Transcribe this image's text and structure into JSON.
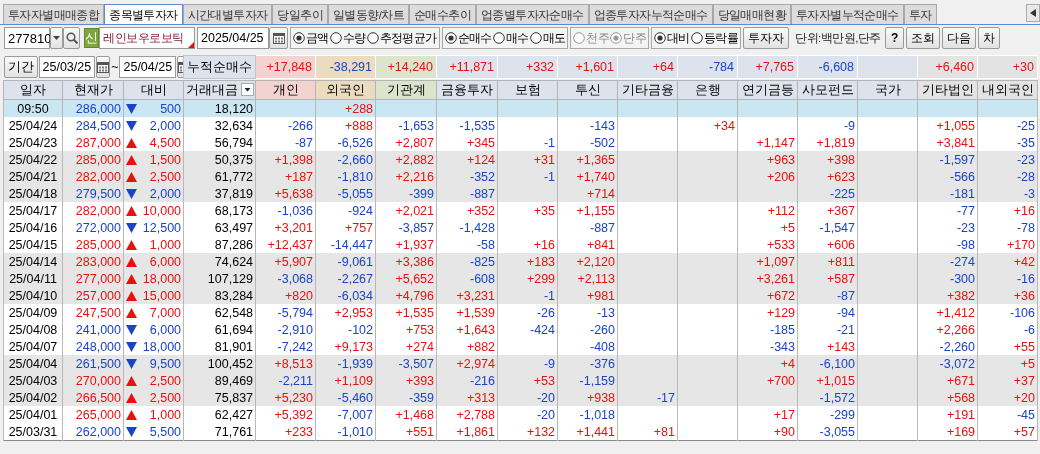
{
  "tabs": [
    {
      "label": "투자자별매매종합",
      "selected": false
    },
    {
      "label": "종목별투자자",
      "selected": true
    },
    {
      "label": "시간대별투자자",
      "selected": false
    },
    {
      "label": "당일추이",
      "selected": false
    },
    {
      "label": "일별동향/차트",
      "selected": false
    },
    {
      "label": "순매수추이",
      "selected": false
    },
    {
      "label": "업종별투자자순매수",
      "selected": false
    },
    {
      "label": "업종투자자누적순매수",
      "selected": false
    },
    {
      "label": "당일매매현황",
      "selected": false
    },
    {
      "label": "투자자별누적순매수",
      "selected": false
    },
    {
      "label": "투자",
      "selected": false
    }
  ],
  "toolbar": {
    "stock_code": "277810",
    "market_badge": "신",
    "stock_name": "레인보우로보틱",
    "date": "2025/04/25",
    "option_groups": [
      {
        "disabled": false,
        "options": [
          {
            "label": "금액",
            "selected": true
          },
          {
            "label": "수량",
            "selected": false
          },
          {
            "label": "추정평균가",
            "selected": false
          }
        ]
      },
      {
        "disabled": false,
        "options": [
          {
            "label": "순매수",
            "selected": true
          },
          {
            "label": "매수",
            "selected": false
          },
          {
            "label": "매도",
            "selected": false
          }
        ]
      },
      {
        "disabled": true,
        "options": [
          {
            "label": "천주",
            "selected": false
          },
          {
            "label": "단주",
            "selected": true
          }
        ]
      },
      {
        "disabled": false,
        "options": [
          {
            "label": "대비",
            "selected": true
          },
          {
            "label": "등락률",
            "selected": false
          }
        ]
      }
    ],
    "investor_button": "투자자",
    "unit": "단위:백만원,단주",
    "buttons": [
      "?",
      "조회",
      "다음",
      "차"
    ]
  },
  "period": {
    "label": "기간",
    "from": "25/03/25",
    "separator": "~",
    "to": "25/04/25"
  },
  "table": {
    "columns": [
      {
        "label": "일자"
      },
      {
        "label": "현재가"
      },
      {
        "label": "대비"
      },
      {
        "label": "거래대금",
        "has_menu": true
      },
      {
        "label": "개인",
        "color": "#f2d3cf"
      },
      {
        "label": "외국인",
        "color": "#ebdcc0"
      },
      {
        "label": "기관계",
        "color": "#dce5cb"
      },
      {
        "label": "금융투자",
        "color": "#dce3ec"
      },
      {
        "label": "보험",
        "color": "#dce3ec"
      },
      {
        "label": "투신",
        "color": "#dce3ec"
      },
      {
        "label": "기타금융",
        "color": "#dce3ec"
      },
      {
        "label": "은행",
        "color": "#dce3ec"
      },
      {
        "label": "연기금등",
        "color": "#dce3ec"
      },
      {
        "label": "사모펀드",
        "color": "#dce3ec"
      },
      {
        "label": "국가",
        "color": "#dce3ec"
      },
      {
        "label": "기타법인",
        "color": "#e3e3e3"
      },
      {
        "label": "내외국인",
        "color": "#e3e3e3"
      }
    ],
    "cumulative": {
      "label": "누적순매수",
      "values": {
        "individual": "+17,848",
        "foreign": "-38,291",
        "institution": "+14,240",
        "financial_investment": "+11,871",
        "insurance": "+332",
        "trust": "+1,601",
        "other_finance": "+64",
        "bank": "-784",
        "pension": "+7,765",
        "private_fund": "-6,608",
        "other_corp": "+6,460",
        "domestic_foreign": "+30"
      }
    },
    "rows": [
      {
        "date": "09:50",
        "price": "286,000",
        "up": false,
        "change": "500",
        "amount": "18,120",
        "live": true,
        "shaded": false,
        "flows": {
          "foreign": "+288"
        }
      },
      {
        "date": "25/04/24",
        "price": "284,500",
        "up": false,
        "change": "2,000",
        "amount": "32,634",
        "live": false,
        "shaded": false,
        "flows": {
          "individual": "-266",
          "foreign": "+888",
          "institution": "-1,653",
          "financial_investment": "-1,535",
          "trust": "-143",
          "bank": "+34",
          "private_fund": "-9",
          "other_corp": "+1,055",
          "domestic_foreign": "-25"
        }
      },
      {
        "date": "25/04/23",
        "price": "287,000",
        "up": true,
        "change": "4,500",
        "amount": "56,794",
        "live": false,
        "shaded": false,
        "flows": {
          "individual": "-87",
          "foreign": "-6,526",
          "institution": "+2,807",
          "financial_investment": "+345",
          "insurance": "-1",
          "trust": "-502",
          "pension": "+1,147",
          "private_fund": "+1,819",
          "other_corp": "+3,841",
          "domestic_foreign": "-35"
        }
      },
      {
        "date": "25/04/22",
        "price": "285,000",
        "up": true,
        "change": "1,500",
        "amount": "50,375",
        "live": false,
        "shaded": true,
        "flows": {
          "individual": "+1,398",
          "foreign": "-2,660",
          "institution": "+2,882",
          "financial_investment": "+124",
          "insurance": "+31",
          "trust": "+1,365",
          "pension": "+963",
          "private_fund": "+398",
          "other_corp": "-1,597",
          "domestic_foreign": "-23"
        }
      },
      {
        "date": "25/04/21",
        "price": "282,000",
        "up": true,
        "change": "2,500",
        "amount": "61,772",
        "live": false,
        "shaded": true,
        "flows": {
          "individual": "+187",
          "foreign": "-1,810",
          "institution": "+2,216",
          "financial_investment": "-352",
          "insurance": "-1",
          "trust": "+1,740",
          "pension": "+206",
          "private_fund": "+623",
          "other_corp": "-566",
          "domestic_foreign": "-28"
        }
      },
      {
        "date": "25/04/18",
        "price": "279,500",
        "up": false,
        "change": "2,000",
        "amount": "37,819",
        "live": false,
        "shaded": true,
        "flows": {
          "individual": "+5,638",
          "foreign": "-5,055",
          "institution": "-399",
          "financial_investment": "-887",
          "trust": "+714",
          "private_fund": "-225",
          "other_corp": "-181",
          "domestic_foreign": "-3"
        }
      },
      {
        "date": "25/04/17",
        "price": "282,000",
        "up": true,
        "change": "10,000",
        "amount": "68,173",
        "live": false,
        "shaded": false,
        "flows": {
          "individual": "-1,036",
          "foreign": "-924",
          "institution": "+2,021",
          "financial_investment": "+352",
          "insurance": "+35",
          "trust": "+1,155",
          "pension": "+112",
          "private_fund": "+367",
          "other_corp": "-77",
          "domestic_foreign": "+16"
        }
      },
      {
        "date": "25/04/16",
        "price": "272,000",
        "up": false,
        "change": "12,500",
        "amount": "63,497",
        "live": false,
        "shaded": false,
        "flows": {
          "individual": "+3,201",
          "foreign": "+757",
          "institution": "-3,857",
          "financial_investment": "-1,428",
          "trust": "-887",
          "pension": "+5",
          "private_fund": "-1,547",
          "other_corp": "-23",
          "domestic_foreign": "-78"
        }
      },
      {
        "date": "25/04/15",
        "price": "285,000",
        "up": true,
        "change": "1,000",
        "amount": "87,286",
        "live": false,
        "shaded": false,
        "flows": {
          "individual": "+12,437",
          "foreign": "-14,447",
          "institution": "+1,937",
          "financial_investment": "-58",
          "insurance": "+16",
          "trust": "+841",
          "pension": "+533",
          "private_fund": "+606",
          "other_corp": "-98",
          "domestic_foreign": "+170"
        }
      },
      {
        "date": "25/04/14",
        "price": "283,000",
        "up": true,
        "change": "6,000",
        "amount": "74,624",
        "live": false,
        "shaded": true,
        "flows": {
          "individual": "+5,907",
          "foreign": "-9,061",
          "institution": "+3,386",
          "financial_investment": "-825",
          "insurance": "+183",
          "trust": "+2,120",
          "pension": "+1,097",
          "private_fund": "+811",
          "other_corp": "-274",
          "domestic_foreign": "+42"
        }
      },
      {
        "date": "25/04/11",
        "price": "277,000",
        "up": true,
        "change": "18,000",
        "amount": "107,129",
        "live": false,
        "shaded": true,
        "flows": {
          "individual": "-3,068",
          "foreign": "-2,267",
          "institution": "+5,652",
          "financial_investment": "-608",
          "insurance": "+299",
          "trust": "+2,113",
          "pension": "+3,261",
          "private_fund": "+587",
          "other_corp": "-300",
          "domestic_foreign": "-16"
        }
      },
      {
        "date": "25/04/10",
        "price": "257,000",
        "up": true,
        "change": "15,000",
        "amount": "83,284",
        "live": false,
        "shaded": true,
        "flows": {
          "individual": "+820",
          "foreign": "-6,034",
          "institution": "+4,796",
          "financial_investment": "+3,231",
          "insurance": "-1",
          "trust": "+981",
          "pension": "+672",
          "private_fund": "-87",
          "other_corp": "+382",
          "domestic_foreign": "+36"
        }
      },
      {
        "date": "25/04/09",
        "price": "247,500",
        "up": true,
        "change": "7,000",
        "amount": "62,548",
        "live": false,
        "shaded": false,
        "flows": {
          "individual": "-5,794",
          "foreign": "+2,953",
          "institution": "+1,535",
          "financial_investment": "+1,539",
          "insurance": "-26",
          "trust": "-13",
          "pension": "+129",
          "private_fund": "-94",
          "other_corp": "+1,412",
          "domestic_foreign": "-106"
        }
      },
      {
        "date": "25/04/08",
        "price": "241,000",
        "up": false,
        "change": "6,000",
        "amount": "61,694",
        "live": false,
        "shaded": false,
        "flows": {
          "individual": "-2,910",
          "foreign": "-102",
          "institution": "+753",
          "financial_investment": "+1,643",
          "insurance": "-424",
          "trust": "-260",
          "pension": "-185",
          "private_fund": "-21",
          "other_corp": "+2,266",
          "domestic_foreign": "-6"
        }
      },
      {
        "date": "25/04/07",
        "price": "248,000",
        "up": false,
        "change": "18,000",
        "amount": "81,901",
        "live": false,
        "shaded": false,
        "flows": {
          "individual": "-7,242",
          "foreign": "+9,173",
          "institution": "+274",
          "financial_investment": "+882",
          "trust": "-408",
          "pension": "-343",
          "private_fund": "+143",
          "other_corp": "-2,260",
          "domestic_foreign": "+55"
        }
      },
      {
        "date": "25/04/04",
        "price": "261,500",
        "up": false,
        "change": "9,500",
        "amount": "100,452",
        "live": false,
        "shaded": true,
        "flows": {
          "individual": "+8,513",
          "foreign": "-1,939",
          "institution": "-3,507",
          "financial_investment": "+2,974",
          "insurance": "-9",
          "trust": "-376",
          "pension": "+4",
          "private_fund": "-6,100",
          "other_corp": "-3,072",
          "domestic_foreign": "+5"
        }
      },
      {
        "date": "25/04/03",
        "price": "270,000",
        "up": true,
        "change": "2,500",
        "amount": "89,469",
        "live": false,
        "shaded": true,
        "flows": {
          "individual": "-2,211",
          "foreign": "+1,109",
          "institution": "+393",
          "financial_investment": "-216",
          "insurance": "+53",
          "trust": "-1,159",
          "pension": "+700",
          "private_fund": "+1,015",
          "other_corp": "+671",
          "domestic_foreign": "+37"
        }
      },
      {
        "date": "25/04/02",
        "price": "266,500",
        "up": true,
        "change": "2,500",
        "amount": "75,837",
        "live": false,
        "shaded": true,
        "flows": {
          "individual": "+5,230",
          "foreign": "-5,460",
          "institution": "-359",
          "financial_investment": "+313",
          "insurance": "-20",
          "trust": "+938",
          "other_finance": "-17",
          "private_fund": "-1,572",
          "other_corp": "+568",
          "domestic_foreign": "+20"
        }
      },
      {
        "date": "25/04/01",
        "price": "265,000",
        "up": true,
        "change": "1,000",
        "amount": "62,427",
        "live": false,
        "shaded": false,
        "flows": {
          "individual": "+5,392",
          "foreign": "-7,007",
          "institution": "+1,468",
          "financial_investment": "+2,788",
          "insurance": "-20",
          "trust": "-1,018",
          "pension": "+17",
          "private_fund": "-299",
          "other_corp": "+191",
          "domestic_foreign": "-45"
        }
      },
      {
        "date": "25/03/31",
        "price": "262,000",
        "up": false,
        "change": "5,500",
        "amount": "71,761",
        "live": false,
        "shaded": false,
        "flows": {
          "individual": "+233",
          "foreign": "-1,010",
          "institution": "+551",
          "financial_investment": "+1,861",
          "insurance": "+132",
          "trust": "+1,441",
          "other_finance": "+81",
          "pension": "+90",
          "private_fund": "-3,055",
          "other_corp": "+169",
          "domestic_foreign": "+57"
        }
      }
    ]
  }
}
